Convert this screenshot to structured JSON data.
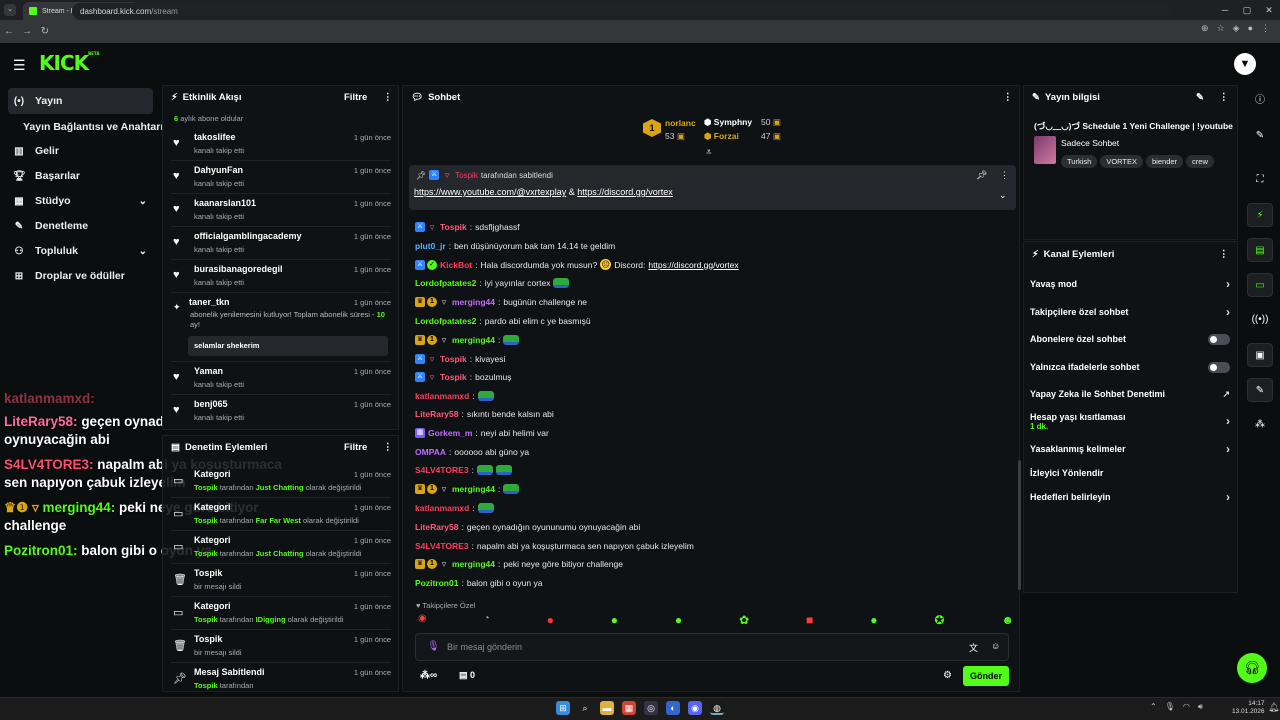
{
  "browser": {
    "tab_title": "Stream - Kick Dashboard",
    "url_host": "dashboard.kick.com",
    "url_path": "/stream"
  },
  "app": {
    "logo": "KICK",
    "logo_sup": "BETA",
    "avatar_glyph": "▼"
  },
  "sidebar": {
    "items": [
      {
        "label": "Yayın",
        "icon": "broadcast-icon"
      },
      {
        "label": "Yayın Bağlantısı ve Anahtarı"
      },
      {
        "label": "Gelir",
        "icon": "revenue-icon"
      },
      {
        "label": "Başarılar",
        "icon": "trophy-icon"
      },
      {
        "label": "Stüdyo",
        "icon": "studio-icon"
      },
      {
        "label": "Denetleme",
        "icon": "wrench-icon"
      },
      {
        "label": "Topluluk",
        "icon": "community-icon"
      },
      {
        "label": "Droplar ve ödüller",
        "icon": "gift-icon"
      }
    ]
  },
  "overlay_chat": [
    {
      "user": "katlanmamxd:",
      "msg": ""
    },
    {
      "user": "LiteRary58:",
      "msg": "geçen oynadığın oyununumu oynuyacağin abi"
    },
    {
      "user": "S4LV4TORE3:",
      "msg": "napalm abi ya koşuşturmaca sen napıyon çabuk izleyelim"
    },
    {
      "user": "merging44:",
      "msg": "peki neye göre bitiyor challenge"
    },
    {
      "user": "Pozitron01:",
      "msg": "balon gibi o oyun ya"
    }
  ],
  "activity": {
    "title": "Etkinlik Akışı",
    "filter": "Filtre",
    "top_note_count": "6",
    "top_note": "aylık abone oldular",
    "events": [
      {
        "name": "takoslifee",
        "desc": "kanalı takip etti",
        "time": "1 gün önce"
      },
      {
        "name": "DahyunFan",
        "desc": "kanalı takip etti",
        "time": "1 gün önce"
      },
      {
        "name": "kaanarslan101",
        "desc": "kanalı takip etti",
        "time": "1 gün önce"
      },
      {
        "name": "officialgamblingacademy",
        "desc": "kanalı takip etti",
        "time": "1 gün önce"
      },
      {
        "name": "burasibanagoredegil",
        "desc": "kanalı takip etti",
        "time": "1 gün önce"
      }
    ],
    "resub": {
      "name": "taner_tkn",
      "time": "1 gün önce",
      "desc": "abonelik yenilemesini kutluyor! Toplam abonelik süresi - ",
      "months": "10",
      "desc_end": " ay!",
      "message": "selamlar shekerim"
    },
    "events2": [
      {
        "name": "Yaman",
        "desc": "kanalı takip etti",
        "time": "1 gün önce"
      },
      {
        "name": "benj065",
        "desc": "kanalı takip etti",
        "time": "1 gün önce"
      }
    ]
  },
  "moderation": {
    "title": "Denetim Eylemleri",
    "filter": "Filtre",
    "items": [
      {
        "name": "Kategori",
        "by": "Tospik",
        "mid": " tarafından ",
        "target": "Just Chatting",
        "end": " olarak değiştirildi",
        "time": "1 gün önce",
        "icon": "category-icon"
      },
      {
        "name": "Kategori",
        "by": "Tospik",
        "mid": " tarafından ",
        "target": "Far Far West",
        "end": " olarak değiştirildi",
        "time": "1 gün önce",
        "icon": "category-icon"
      },
      {
        "name": "Kategori",
        "by": "Tospik",
        "mid": " tarafından ",
        "target": "Just Chatting",
        "end": " olarak değiştirildi",
        "time": "1 gün önce",
        "icon": "category-icon"
      },
      {
        "name": "Tospik",
        "by": "",
        "mid": "bir mesajı sildi",
        "target": "",
        "end": "",
        "time": "1 gün önce",
        "icon": "trash-icon"
      },
      {
        "name": "Kategori",
        "by": "Tospik",
        "mid": " tarafından ",
        "target": "IDigging",
        "end": " olarak değiştirildi",
        "time": "1 gün önce",
        "icon": "category-icon"
      },
      {
        "name": "Tospik",
        "by": "",
        "mid": "bir mesajı sildi",
        "target": "",
        "end": "",
        "time": "1 gün önce",
        "icon": "trash-icon"
      },
      {
        "name": "Mesaj Sabitlendi",
        "by": "Tospik",
        "mid": " tarafından",
        "target": "",
        "end": "",
        "time": "1 gün önce",
        "icon": "pin-icon"
      }
    ]
  },
  "chat": {
    "title": "Sohbet",
    "leaderboard": [
      {
        "rank": "1",
        "name": "norlanc",
        "value": "53"
      },
      {
        "name": "Symphny",
        "value": "50"
      },
      {
        "name": "Forzai",
        "value": "47"
      }
    ],
    "pinned": {
      "by": "Tospik",
      "label": "tarafından sabitlendi",
      "link1": "https://www.youtube.com/@vxrtexplay",
      "amp": "&",
      "link2": "https://discord.gg/vortex"
    },
    "messages": [
      {
        "user": "Tospik",
        "text": "sdsfljghassf",
        "color": "pink"
      },
      {
        "user": "plut0_jr",
        "text": "ben düşünüyorum bak tam 14.14 te geldim",
        "color": "blue"
      },
      {
        "user": "KickBot",
        "text": "Hala discordumda yok musun?",
        "text2": "Discord:",
        "link": "https://discord.gg/vortex",
        "color": "red"
      },
      {
        "user": "Lordofpatates2",
        "text": "iyi yayınlar cortex",
        "color": "green"
      },
      {
        "user": "merging44",
        "text": "bugünün challenge ne",
        "color": "purple"
      },
      {
        "user": "Lordofpatates2",
        "text": "pardo abi elim c ye basmışü",
        "color": "green"
      },
      {
        "user": "merging44",
        "text": "",
        "color": "green"
      },
      {
        "user": "Tospik",
        "text": "kivayesi",
        "color": "pink"
      },
      {
        "user": "Tospik",
        "text": "bozulmuş",
        "color": "pink"
      },
      {
        "user": "katlanmamxd",
        "text": "",
        "color": "red"
      },
      {
        "user": "LiteRary58",
        "text": "sıkıntı bende kalsın abi",
        "color": "pink"
      },
      {
        "user": "Gorkem_m",
        "text": "neyi abi helimi var",
        "color": "purple"
      },
      {
        "user": "OMPAA",
        "text": "oooooo abi güno ya",
        "color": "purple"
      },
      {
        "user": "S4LV4TORE3",
        "text": "",
        "color": "red"
      },
      {
        "user": "merging44",
        "text": "",
        "color": "green"
      },
      {
        "user": "katlanmamxd",
        "text": "",
        "color": "red"
      },
      {
        "user": "LiteRary58",
        "text": "geçen oynadığın oyununumu oynuyacağin abi",
        "color": "pink"
      },
      {
        "user": "S4LV4TORE3",
        "text": "napalm abi ya koşuşturmaca sen napıyon çabuk izleyelim",
        "color": "red"
      },
      {
        "user": "merging44",
        "text": "peki neye göre bitiyor challenge",
        "color": "green"
      },
      {
        "user": "Pozitron01",
        "text": "balon gibi o oyun ya",
        "color": "green"
      }
    ],
    "followers_only": "Takipçilere Özel",
    "input_placeholder": "Bir mesaj gönderin",
    "points": "∞",
    "bag_count": "0",
    "send_label": "Gönder"
  },
  "stream_info": {
    "title": "Yayın bilgisi",
    "stream_title": "(づ◡﹏◡)づ Schedule 1 Yeni Challenge | !youtube",
    "category": "Sadece Sohbet",
    "tags": [
      "Turkish",
      "VORTEX",
      "biender",
      "crew"
    ]
  },
  "channel_actions": {
    "title": "Kanal Eylemleri",
    "rows": [
      {
        "label": "Yavaş mod",
        "kind": "chevron"
      },
      {
        "label": "Takipçilere özel sohbet",
        "kind": "chevron"
      },
      {
        "label": "Abonelere özel sohbet",
        "kind": "toggle"
      },
      {
        "label": "Yalnızca ifadelerle sohbet",
        "kind": "toggle"
      },
      {
        "label": "Yapay Zeka ile Sohbet Denetimi",
        "kind": "external"
      },
      {
        "label": "Hesap yaşı kısıtlaması",
        "sub": "1 dk.",
        "kind": "chevron"
      },
      {
        "label": "Yasaklanmış kelimeler",
        "kind": "chevron"
      },
      {
        "label": "İzleyici Yönlendir",
        "kind": "none"
      },
      {
        "label": "Hedefleri belirleyin",
        "kind": "chevron"
      }
    ]
  },
  "taskbar": {
    "time": "14:17",
    "date": "13.01.2026"
  },
  "colors": {
    "brand": "#53fc18",
    "bg": "#0b0e0f",
    "panel": "#0f1214"
  }
}
